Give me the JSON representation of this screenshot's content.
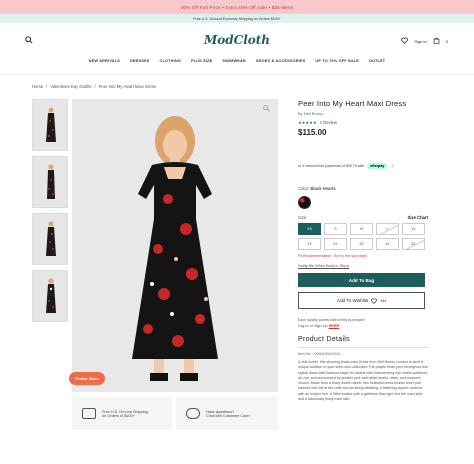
{
  "promo": {
    "text": "30% Off Full Price • Extra 40% Off Sale • $35 Mens"
  },
  "shipping_banner": {
    "text": "Free U.S. Ground Economy Shipping on Orders $100+"
  },
  "header": {
    "logo": "ModCloth",
    "signin": "Sign In",
    "bag_count": "0",
    "nav": [
      "NEW ARRIVALS",
      "DRESSES",
      "CLOTHING",
      "PLUS SIZE",
      "SWIMWEAR",
      "SHOES & ACCESSORIES",
      "UP TO 70% OFF SALE",
      "OUTLET"
    ]
  },
  "breadcrumb": [
    "Home",
    "/",
    "Valentines Day Outfits",
    "/",
    "Peer Into My Heart Maxi Dress"
  ],
  "gallery": {
    "badge": "Similar Vibes"
  },
  "perks": [
    {
      "line1": "Free U.S. Ground Shipping",
      "line2": "on Orders of $100+"
    },
    {
      "line1": "Have questions?",
      "line2": "Chat with Customer Care!"
    }
  ],
  "product": {
    "title": "Peer Into My Heart Maxi Dress",
    "brand": "By Hell Bunny",
    "stars": "★★★★★",
    "rating": 5,
    "reviews": "1 Review",
    "price": "$115.00",
    "afterpay_text": "or 4 interest-free payments of $28.75 with",
    "afterpay_label": "afterpay",
    "afterpay_info": "ⓘ",
    "color_label": "Color:",
    "color_value": "Black Hearts",
    "size_label": "Size:",
    "size_chart": "Size Chart",
    "sizes": [
      "XS",
      "S",
      "M",
      "L",
      "XL",
      "1X",
      "2X",
      "3X",
      "4X",
      "5X"
    ],
    "selected_size": "XS",
    "fit_note": "Fit Recommendation: True to the size chart",
    "notify": "Notify Me When Back in Stock",
    "add_to_bag": "Add To Bag",
    "add_to_wishlist": "Add To Wishlist",
    "wishlist_count": "344",
    "loyalty1": "Earn loyalty points with every purchase!",
    "loyalty2a": "Log In or Sign Up",
    "loyalty2b": "HERE",
    "details_title": "Product Details",
    "sku": "Item No. 10000100421641",
    "description": "A real looker, this stunning black maxi Dress from Hell Bunny London is such a unique addition to your semi-chic collection! The playful heart print throughout this stylish dress skirt features large red hearts with mesmerizing eye motifs scattered all over and surrounded by smaller pink and white hearts, stars, and crescent moons. Made from a flowy woven fabric, this beautiful dress boasts short puff sleeves with frill at the cuffs and tie-string detailing, a flattering square neckline with an empire line, a fitted bodice with a gathered flow right into the maxi skirt, and a fabulously flowy maxi skirt."
  },
  "colors": {
    "brand": "#1e5f5b",
    "accent": "#ef6c4a",
    "promo_bg": "#f8c9cc",
    "ship_bg": "#dff1ee"
  }
}
